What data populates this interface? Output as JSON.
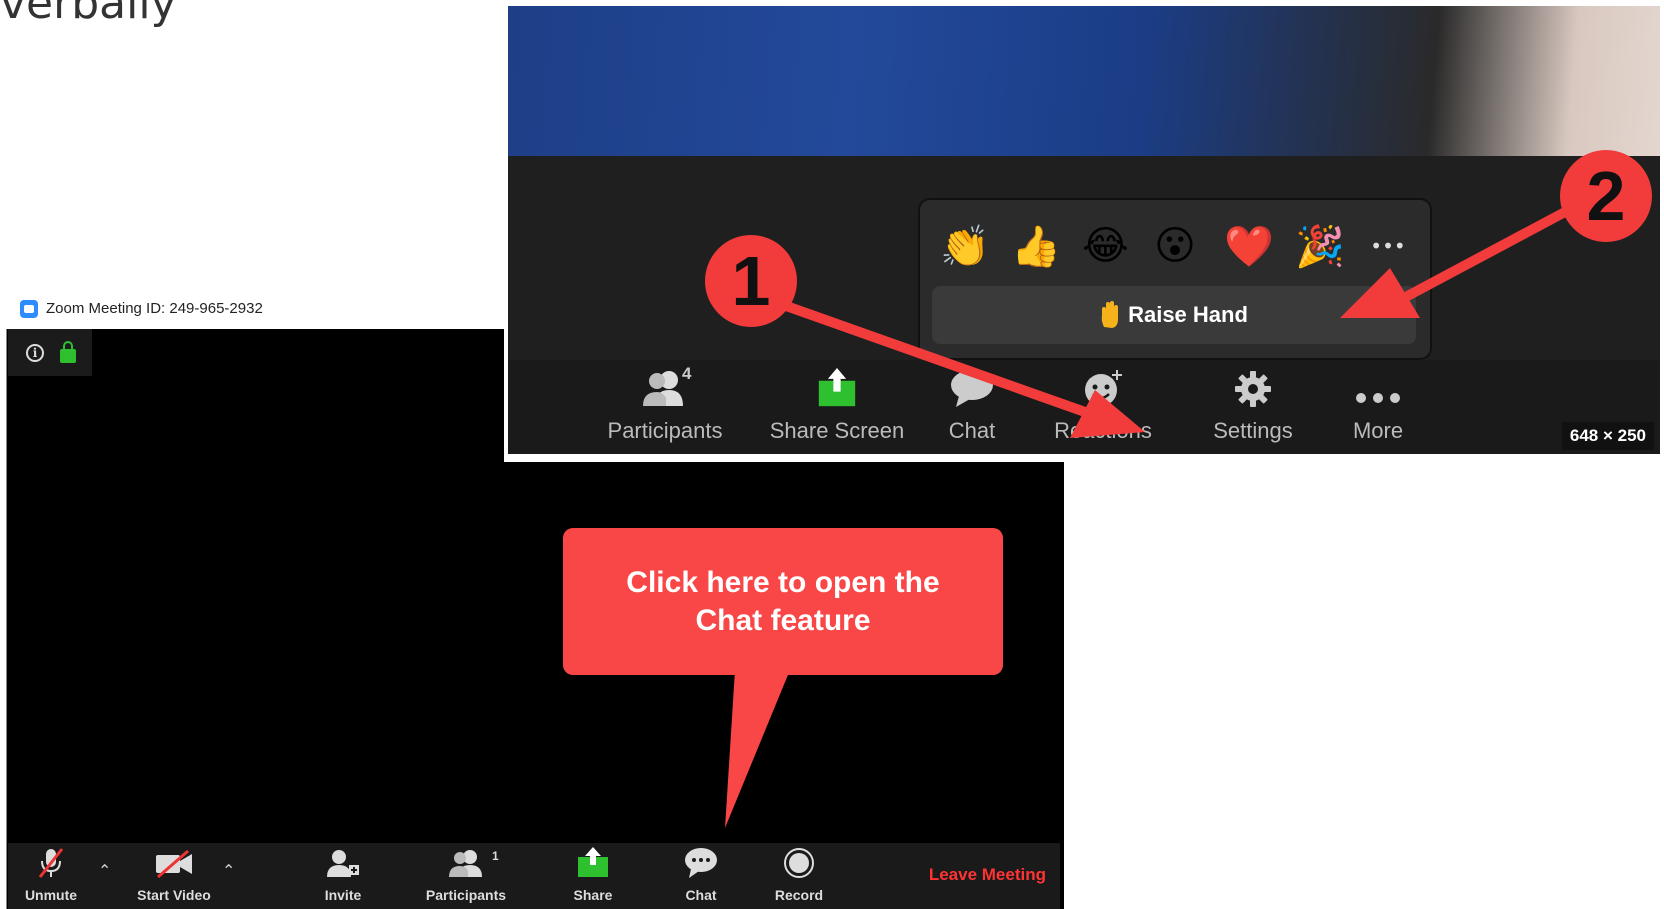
{
  "page": {
    "heading_fragment": "verbally"
  },
  "zoom_window": {
    "title": "Zoom Meeting ID: 249-965-2932",
    "toolbar": {
      "unmute": "Unmute",
      "start_video": "Start Video",
      "invite": "Invite",
      "participants": "Participants",
      "participants_count": "1",
      "share": "Share",
      "chat": "Chat",
      "record": "Record",
      "leave": "Leave Meeting"
    }
  },
  "callout": {
    "text": "Click here to open the Chat feature"
  },
  "inset": {
    "reactions": {
      "emojis": [
        "👏",
        "👍",
        "😂",
        "😮",
        "❤️",
        "🎉",
        "•••"
      ],
      "raise_hand": "Raise Hand"
    },
    "toolbar": {
      "participants": "Participants",
      "participants_count": "4",
      "share_screen": "Share Screen",
      "chat": "Chat",
      "reactions": "Reactions",
      "settings": "Settings",
      "more": "More"
    },
    "dimensions_label": "648 × 250"
  },
  "markers": {
    "one": "1",
    "two": "2"
  },
  "colors": {
    "accent_red": "#f23b3b",
    "zoom_blue": "#2d8cff",
    "share_green": "#2ec02e",
    "leave_red": "#ff3333"
  }
}
